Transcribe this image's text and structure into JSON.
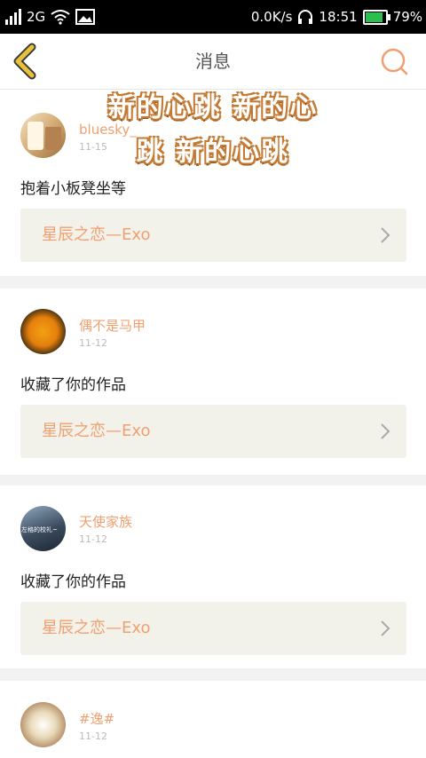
{
  "status_bar": {
    "network": "2G",
    "speed": "0.0K/s",
    "time": "18:51",
    "battery": "79%",
    "battery_level": 0.79
  },
  "header": {
    "title": "消息"
  },
  "overlay": {
    "line1": "新的心跳 新的心",
    "line2": "跳 新的心跳"
  },
  "messages": [
    {
      "name": "bluesky_",
      "time": "11-15",
      "text": "抱着小板凳坐等",
      "ref": "星辰之恋—Exo"
    },
    {
      "name": "偶不是马甲",
      "time": "11-12",
      "text": "收藏了你的作品",
      "ref": "星辰之恋—Exo"
    },
    {
      "name": "天使家族",
      "time": "11-12",
      "text": "收藏了你的作品",
      "ref": "星辰之恋—Exo",
      "avatar_text": "左格的校礼~"
    },
    {
      "name": "#逸#",
      "time": "11-12"
    }
  ],
  "colors": {
    "accent": "#f0a070",
    "back_icon": "#e9c23c",
    "card_ref_bg": "#f3f2ea"
  }
}
